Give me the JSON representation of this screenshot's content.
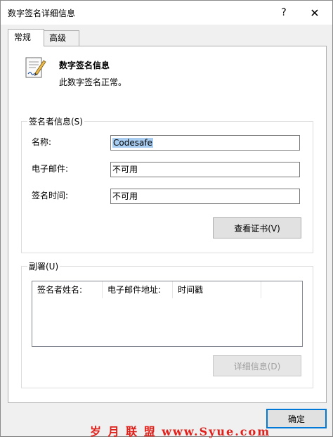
{
  "window": {
    "title": "数字签名详细信息",
    "help_glyph": "?",
    "close_glyph": "✕"
  },
  "tabs": [
    {
      "label": "常规",
      "active": true
    },
    {
      "label": "高级",
      "active": false
    }
  ],
  "info": {
    "icon": "signed-document-icon",
    "title": "数字签名信息",
    "message": "此数字签名正常。"
  },
  "signer": {
    "legend": "签名者信息(S)",
    "name_label": "名称:",
    "name_value": "Codesafe",
    "email_label": "电子邮件:",
    "email_value": "不可用",
    "time_label": "签名时间:",
    "time_value": "不可用",
    "view_cert_label": "查看证书(V)"
  },
  "countersign": {
    "legend": "副署(U)",
    "columns": [
      "签名者姓名:",
      "电子邮件地址:",
      "时间戳"
    ],
    "rows": [],
    "details_label": "详细信息(D)"
  },
  "footer": {
    "ok_label": "确定"
  },
  "watermark": {
    "text": "岁 月 联 盟  www.Syue.com"
  },
  "colors": {
    "accent": "#0078d7",
    "selection": "#a8cdf0",
    "watermark": "#e0201a"
  }
}
